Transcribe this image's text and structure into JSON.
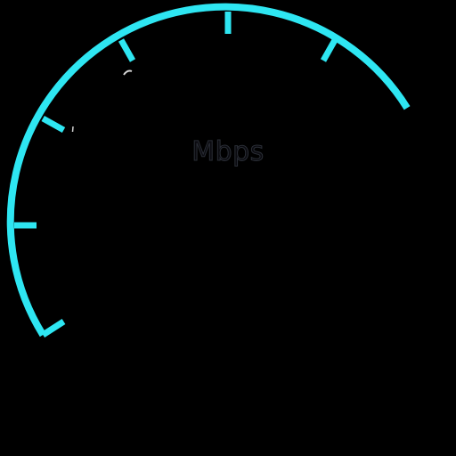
{
  "gauge": {
    "unit": "Mbps",
    "accent_color": "#2ee6f2",
    "background_color": "#000000",
    "unit_color": "#0b0b10",
    "visible_tick_count": 6
  }
}
